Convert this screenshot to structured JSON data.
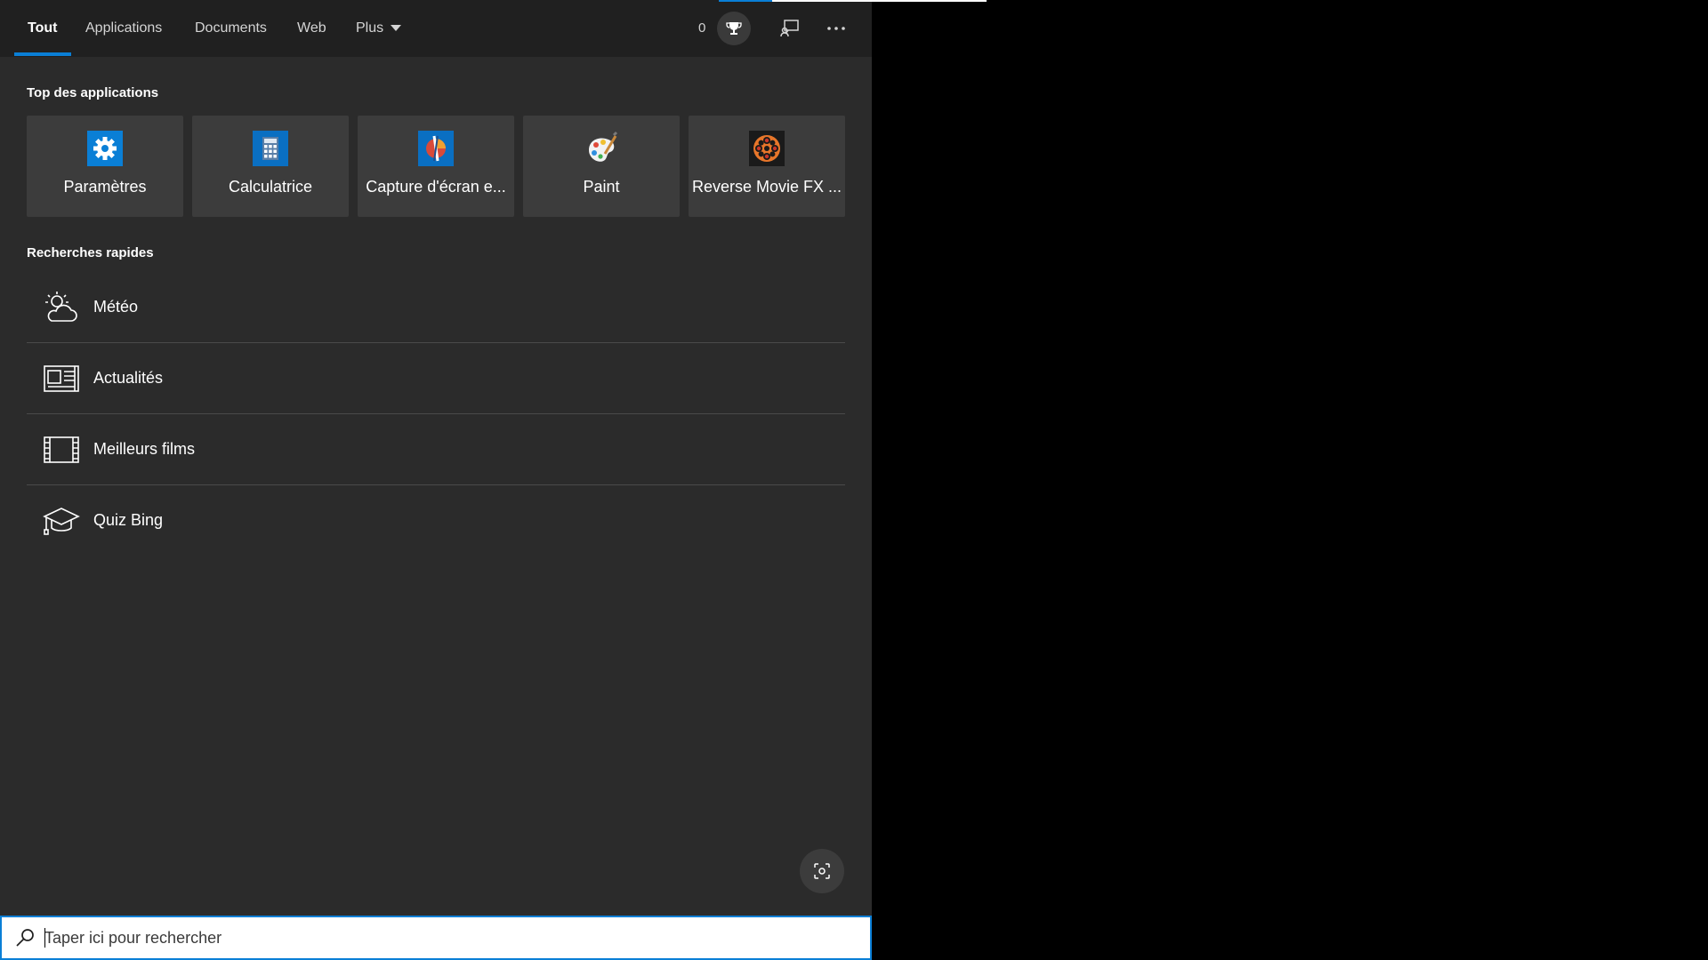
{
  "tabs": [
    {
      "label": "Tout",
      "active": true
    },
    {
      "label": "Applications"
    },
    {
      "label": "Documents"
    },
    {
      "label": "Web"
    },
    {
      "label": "Plus"
    }
  ],
  "header": {
    "points": "0",
    "icons": [
      "trophy-icon",
      "feedback-icon",
      "more-options-icon"
    ]
  },
  "top_apps": {
    "title": "Top des applications",
    "items": [
      {
        "label": "Paramètres",
        "icon": "settings-gear-icon"
      },
      {
        "label": "Calculatrice",
        "icon": "calculator-icon"
      },
      {
        "label": "Capture d'écran e...",
        "icon": "snipping-tool-icon"
      },
      {
        "label": "Paint",
        "icon": "paint-palette-icon"
      },
      {
        "label": "Reverse Movie FX ...",
        "icon": "film-reel-icon"
      }
    ]
  },
  "quick_searches": {
    "title": "Recherches rapides",
    "items": [
      {
        "label": "Météo",
        "icon": "weather-icon"
      },
      {
        "label": "Actualités",
        "icon": "news-icon"
      },
      {
        "label": "Meilleurs films",
        "icon": "film-strip-icon"
      },
      {
        "label": "Quiz Bing",
        "icon": "graduation-cap-icon"
      }
    ]
  },
  "search": {
    "placeholder": "Taper ici pour rechercher",
    "value": ""
  },
  "colors": {
    "accent": "#0a7fd6",
    "panel": "#2b2b2b",
    "tabbar": "#202020",
    "tile": "#3c3c3c"
  }
}
